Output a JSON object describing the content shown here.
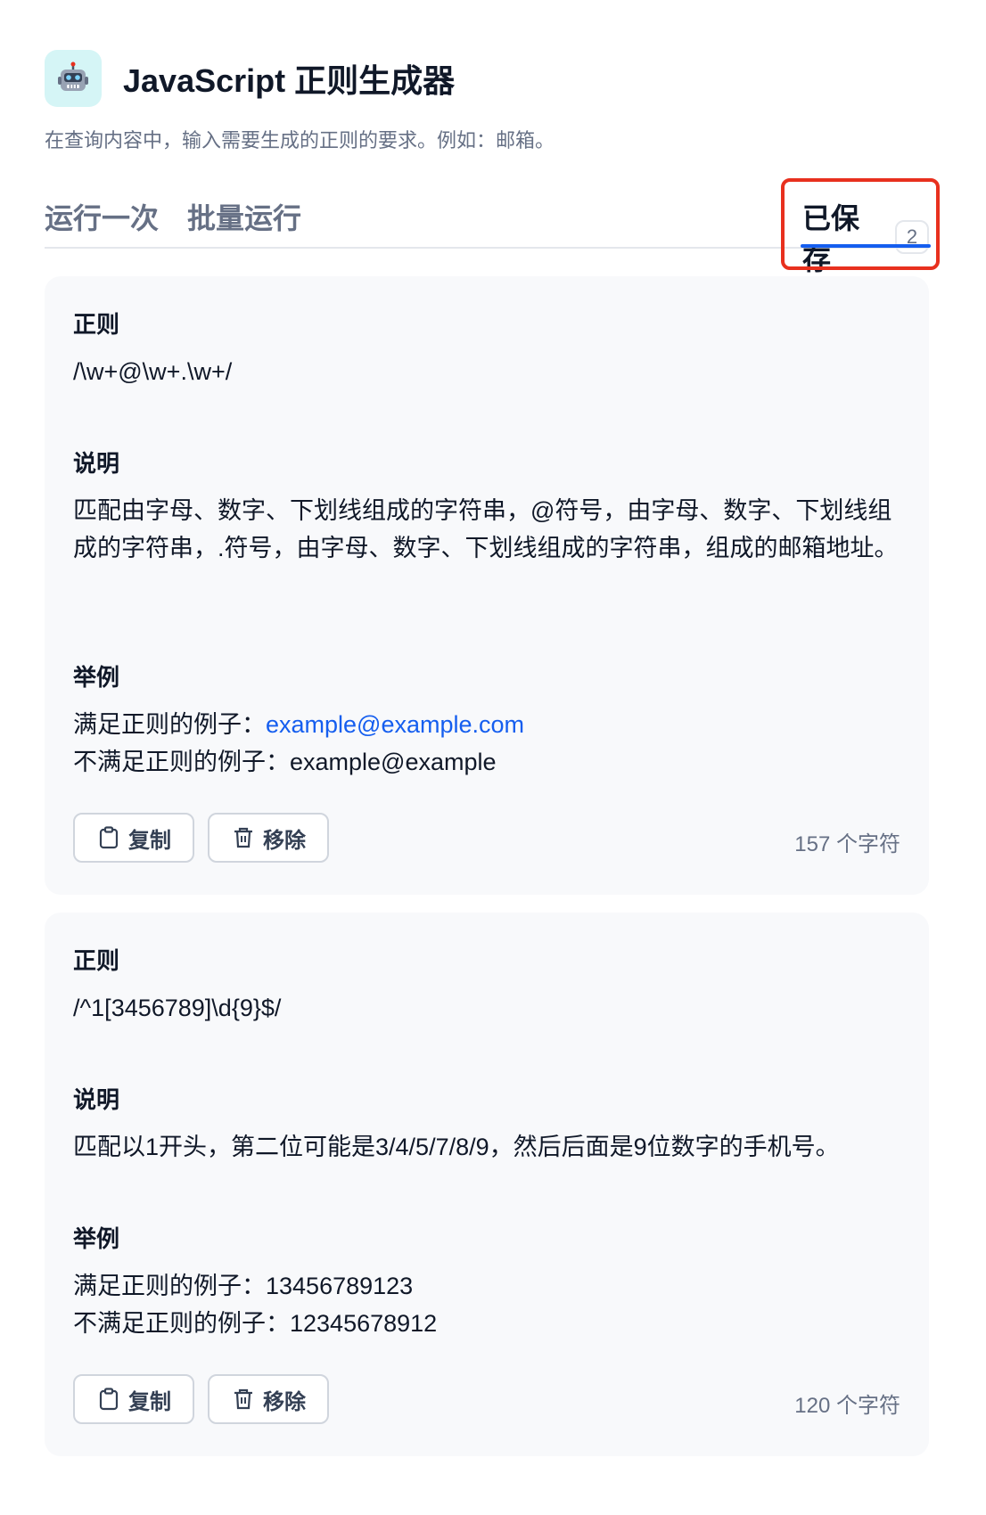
{
  "app": {
    "icon": "robot-icon",
    "title": "JavaScript 正则生成器",
    "description": "在查询内容中，输入需要生成的正则的要求。例如：邮箱。"
  },
  "tabs": {
    "run_once": "运行一次",
    "batch_run": "批量运行",
    "saved": "已保存",
    "saved_count": "2"
  },
  "colors": {
    "accent": "#155eef",
    "highlight": "#e8301e",
    "card_bg": "#f8f9fb"
  },
  "saved_items": [
    {
      "regex_label": "正则",
      "regex": "/\\w+@\\w+.\\w+/",
      "desc_label": "说明",
      "description": "匹配由字母、数字、下划线组成的字符串，@符号，由字母、数字、下划线组成的字符串，.符号，由字母、数字、下划线组成的字符串，组成的邮箱地址。",
      "example_label": "举例",
      "match_prefix": "满足正则的例子：",
      "match_value": "example@example.com",
      "nomatch_prefix": "不满足正则的例子：",
      "nomatch_value": "example@example",
      "copy_label": "复制",
      "remove_label": "移除",
      "char_count": "157 个字符"
    },
    {
      "regex_label": "正则",
      "regex": "/^1[3456789]\\d{9}$/",
      "desc_label": "说明",
      "description": "匹配以1开头，第二位可能是3/4/5/7/8/9，然后后面是9位数字的手机号。",
      "example_label": "举例",
      "match_prefix": "满足正则的例子：",
      "match_value": "13456789123",
      "nomatch_prefix": "不满足正则的例子：",
      "nomatch_value": "12345678912",
      "copy_label": "复制",
      "remove_label": "移除",
      "char_count": "120 个字符"
    }
  ]
}
